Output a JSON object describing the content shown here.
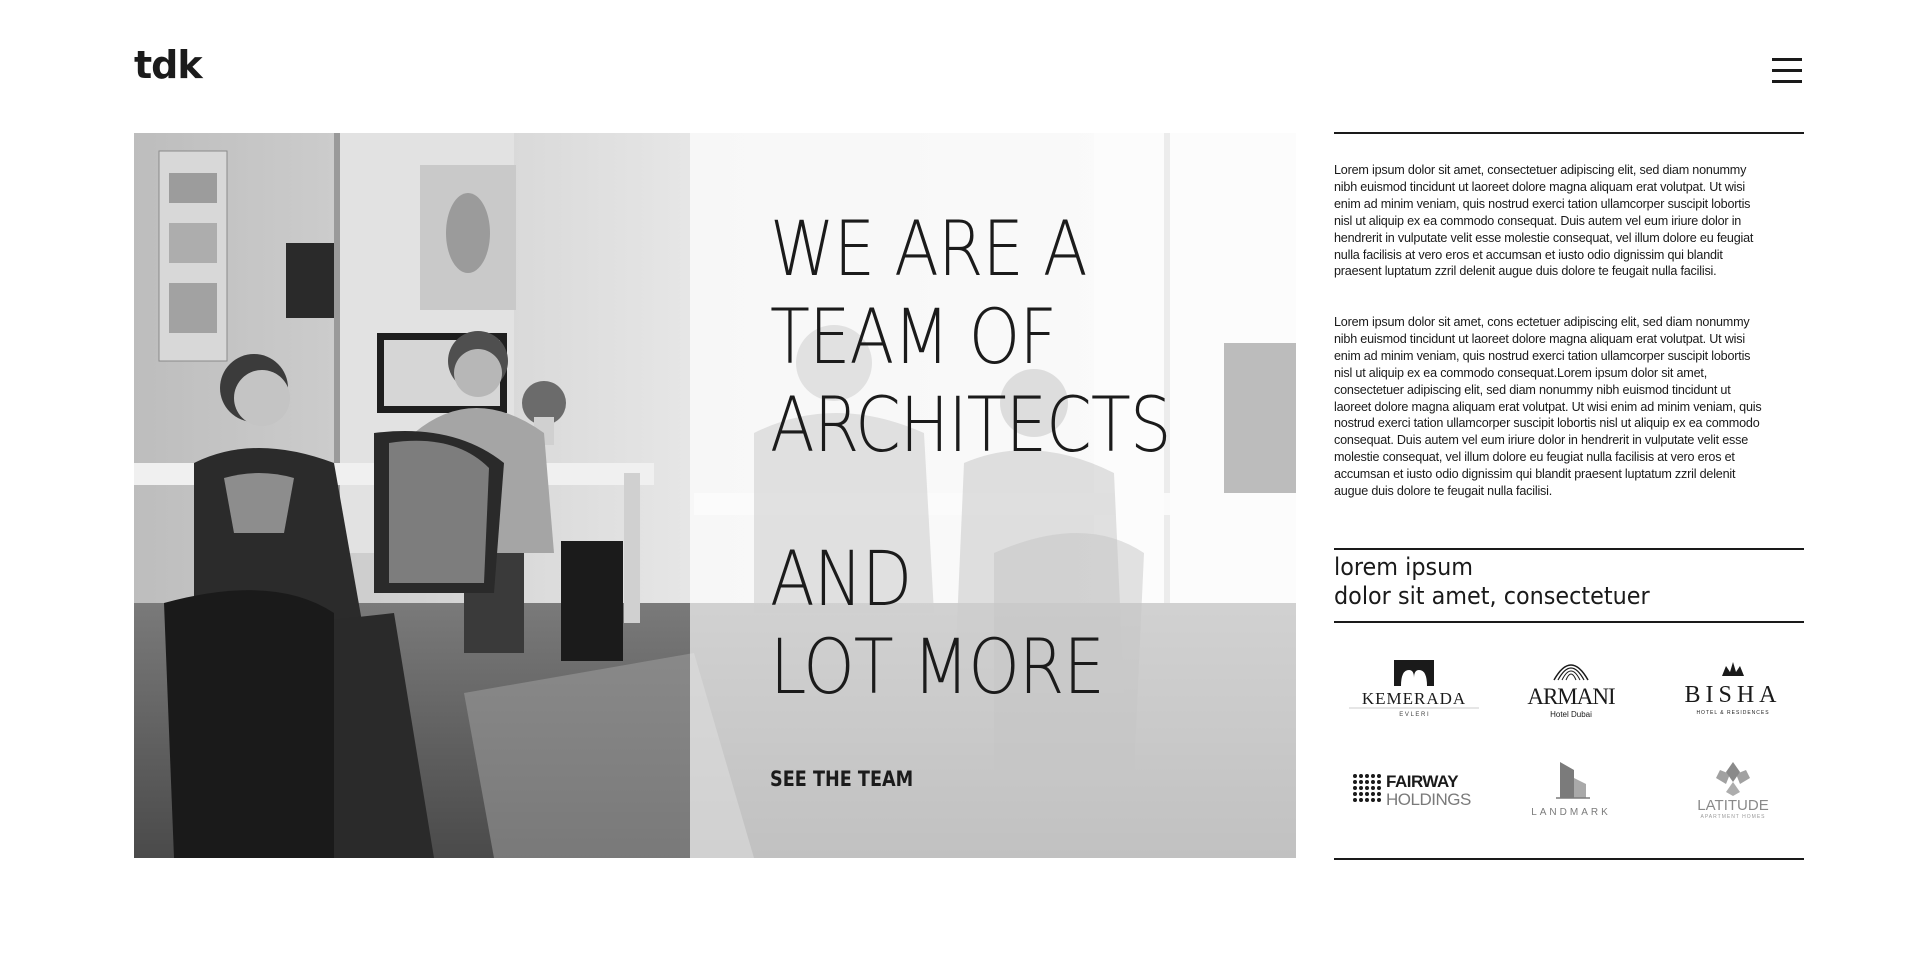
{
  "header": {
    "logo_text": "tdk",
    "menu_icon": "hamburger-menu-icon"
  },
  "hero": {
    "headline_lines": [
      "WE ARE A",
      "TEAM OF",
      "ARCHITECTS",
      "AND",
      "LOT MORE"
    ],
    "cta_label": "SEE THE TEAM"
  },
  "about": {
    "paragraph_1": "Lorem ipsum dolor sit amet, consectetuer adipiscing elit, sed diam nonummy nibh euismod tincidunt ut laoreet dolore magna aliquam erat volutpat. Ut wisi enim ad minim veniam, quis nostrud exerci tation ullamcorper suscipit lobortis nisl ut aliquip ex ea commodo consequat. Duis autem vel eum iriure dolor in hendrerit in vulputate velit esse molestie consequat, vel illum dolore eu feugiat nulla facilisis at vero eros et accumsan et iusto odio dignissim qui blandit praesent luptatum zzril delenit augue duis dolore te feugait nulla facilisi.",
    "paragraph_2": "Lorem ipsum dolor sit amet, cons ectetuer adipiscing elit, sed diam nonummy nibh euismod tincidunt ut laoreet dolore magna aliquam erat volutpat. Ut wisi enim ad minim veniam, quis nostrud exerci tation ullamcorper suscipit lobortis nisl ut aliquip ex ea commodo consequat.Lorem ipsum dolor sit amet, consectetuer adipiscing elit, sed diam nonummy nibh euismod tincidunt ut laoreet dolore magna aliquam erat volutpat. Ut wisi enim ad minim veniam, quis nostrud exerci tation ullamcorper suscipit lobortis nisl ut aliquip ex ea commodo consequat. Duis autem vel eum iriure dolor in hendrerit in vulputate velit esse molestie consequat, vel illum dolore eu feugiat nulla facilisis at vero eros et accumsan et iusto odio dignissim qui blandit praesent luptatum zzril delenit augue duis dolore te feugait nulla facilisi."
  },
  "clients": {
    "subtitle_line_1": "lorem ipsum",
    "subtitle_line_2": "dolor sit amet, consectetuer",
    "logos": [
      {
        "name": "KEMERADA",
        "sub": "E V L E R I"
      },
      {
        "name": "ARMANI",
        "sub": "Hotel Dubai"
      },
      {
        "name": "BISHA",
        "sub": "HOTEL & RESIDENCES"
      },
      {
        "name": "FAIRWAY",
        "sub": "HOLDINGS"
      },
      {
        "name": "LANDMARK",
        "sub": ""
      },
      {
        "name": "LATITUDE",
        "sub": "APARTMENT HOMES"
      }
    ]
  },
  "colors": {
    "text": "#1a1a1a",
    "background": "#ffffff"
  }
}
